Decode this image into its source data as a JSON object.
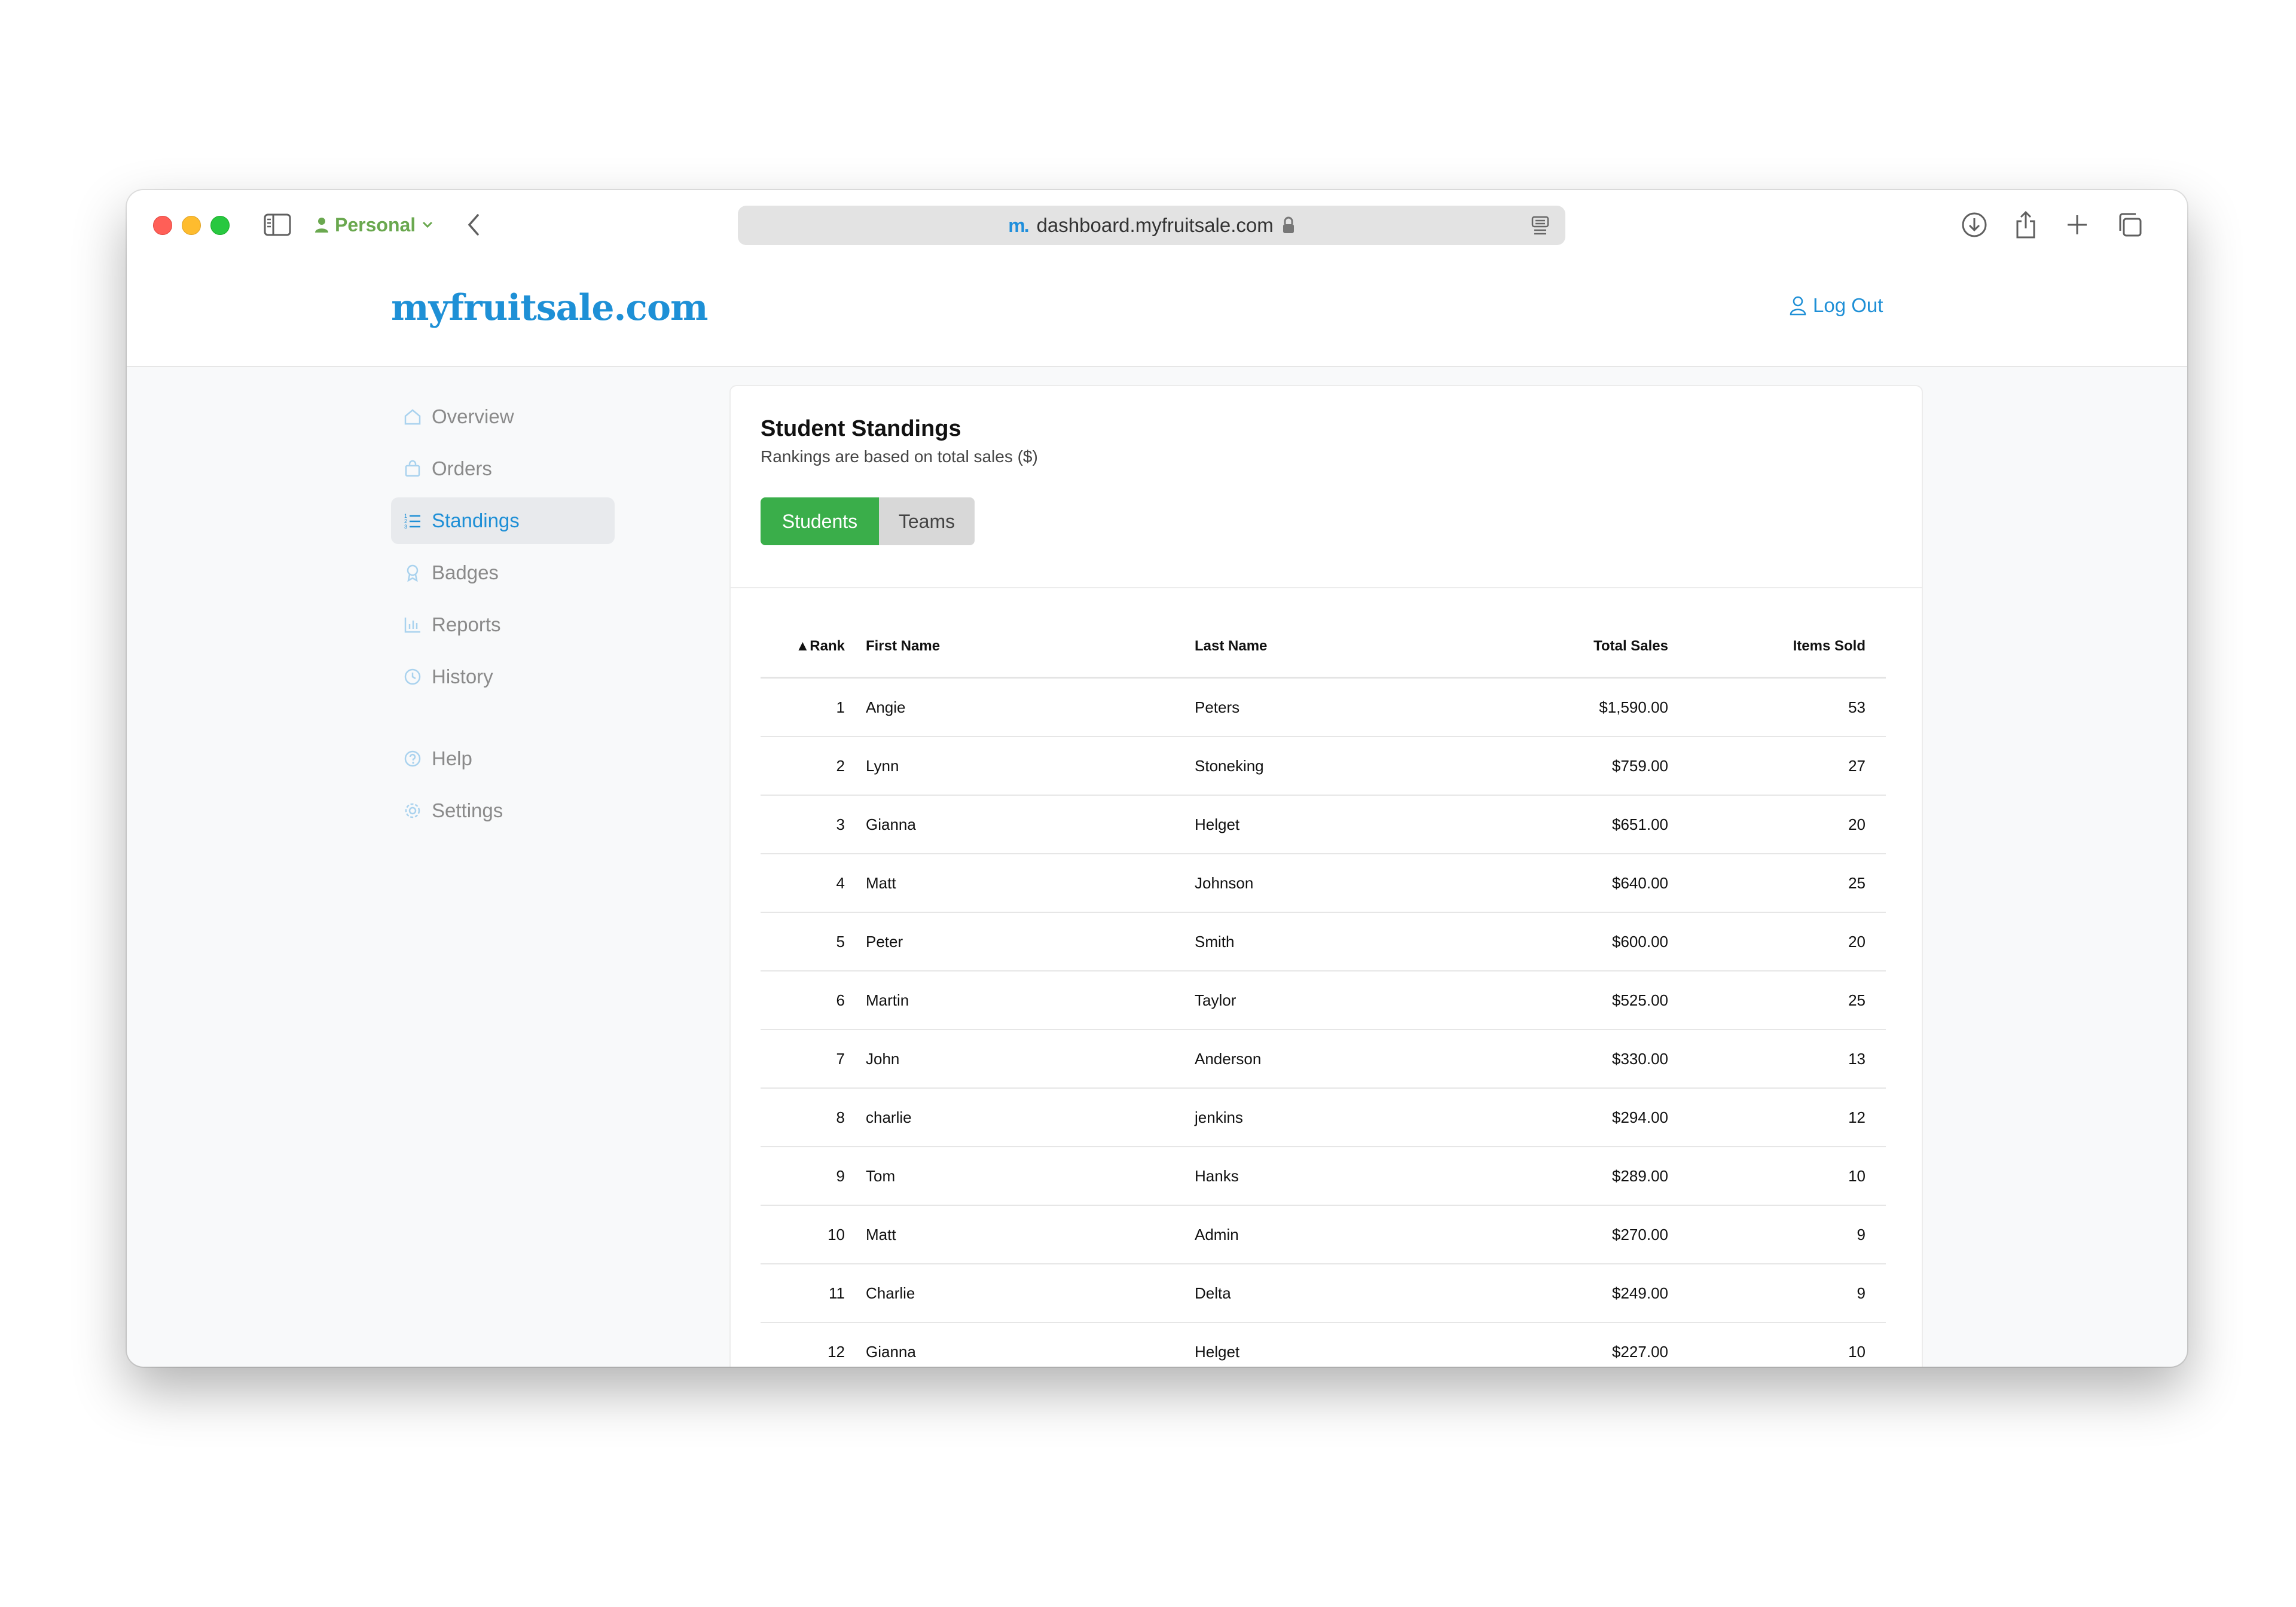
{
  "browser": {
    "profile_label": "Personal",
    "url": "dashboard.myfruitsale.com",
    "favicon_text": "m."
  },
  "site": {
    "logo": "myfruitsale.com",
    "logout_label": "Log Out"
  },
  "sidebar": {
    "items": [
      {
        "label": "Overview",
        "icon": "home-icon"
      },
      {
        "label": "Orders",
        "icon": "shopping-bag-icon"
      },
      {
        "label": "Standings",
        "icon": "list-ordered-icon"
      },
      {
        "label": "Badges",
        "icon": "award-icon"
      },
      {
        "label": "Reports",
        "icon": "bar-chart-icon"
      },
      {
        "label": "History",
        "icon": "clock-icon"
      }
    ],
    "secondary": [
      {
        "label": "Help",
        "icon": "help-circle-icon"
      },
      {
        "label": "Settings",
        "icon": "gear-icon"
      }
    ],
    "active": "Standings"
  },
  "main": {
    "title": "Student Standings",
    "subtitle": "Rankings are based on total sales ($)",
    "tabs": [
      {
        "label": "Students",
        "active": true
      },
      {
        "label": "Teams",
        "active": false
      }
    ],
    "table": {
      "headers": {
        "rank": "▲Rank",
        "first": "First Name",
        "last": "Last Name",
        "total": "Total Sales",
        "items": "Items Sold"
      },
      "rows": [
        {
          "rank": "1",
          "first": "Angie",
          "last": "Peters",
          "total": "$1,590.00",
          "items": "53"
        },
        {
          "rank": "2",
          "first": "Lynn",
          "last": "Stoneking",
          "total": "$759.00",
          "items": "27"
        },
        {
          "rank": "3",
          "first": "Gianna",
          "last": "Helget",
          "total": "$651.00",
          "items": "20"
        },
        {
          "rank": "4",
          "first": "Matt",
          "last": "Johnson",
          "total": "$640.00",
          "items": "25"
        },
        {
          "rank": "5",
          "first": "Peter",
          "last": "Smith",
          "total": "$600.00",
          "items": "20"
        },
        {
          "rank": "6",
          "first": "Martin",
          "last": "Taylor",
          "total": "$525.00",
          "items": "25"
        },
        {
          "rank": "7",
          "first": "John",
          "last": "Anderson",
          "total": "$330.00",
          "items": "13"
        },
        {
          "rank": "8",
          "first": "charlie",
          "last": "jenkins",
          "total": "$294.00",
          "items": "12"
        },
        {
          "rank": "9",
          "first": "Tom",
          "last": "Hanks",
          "total": "$289.00",
          "items": "10"
        },
        {
          "rank": "10",
          "first": "Matt",
          "last": "Admin",
          "total": "$270.00",
          "items": "9"
        },
        {
          "rank": "11",
          "first": "Charlie",
          "last": "Delta",
          "total": "$249.00",
          "items": "9"
        },
        {
          "rank": "12",
          "first": "Gianna",
          "last": "Helget",
          "total": "$227.00",
          "items": "10"
        }
      ]
    }
  },
  "colors": {
    "brand": "#1e90d6",
    "active_tab": "#3aae4a",
    "profile": "#6aa84f"
  }
}
